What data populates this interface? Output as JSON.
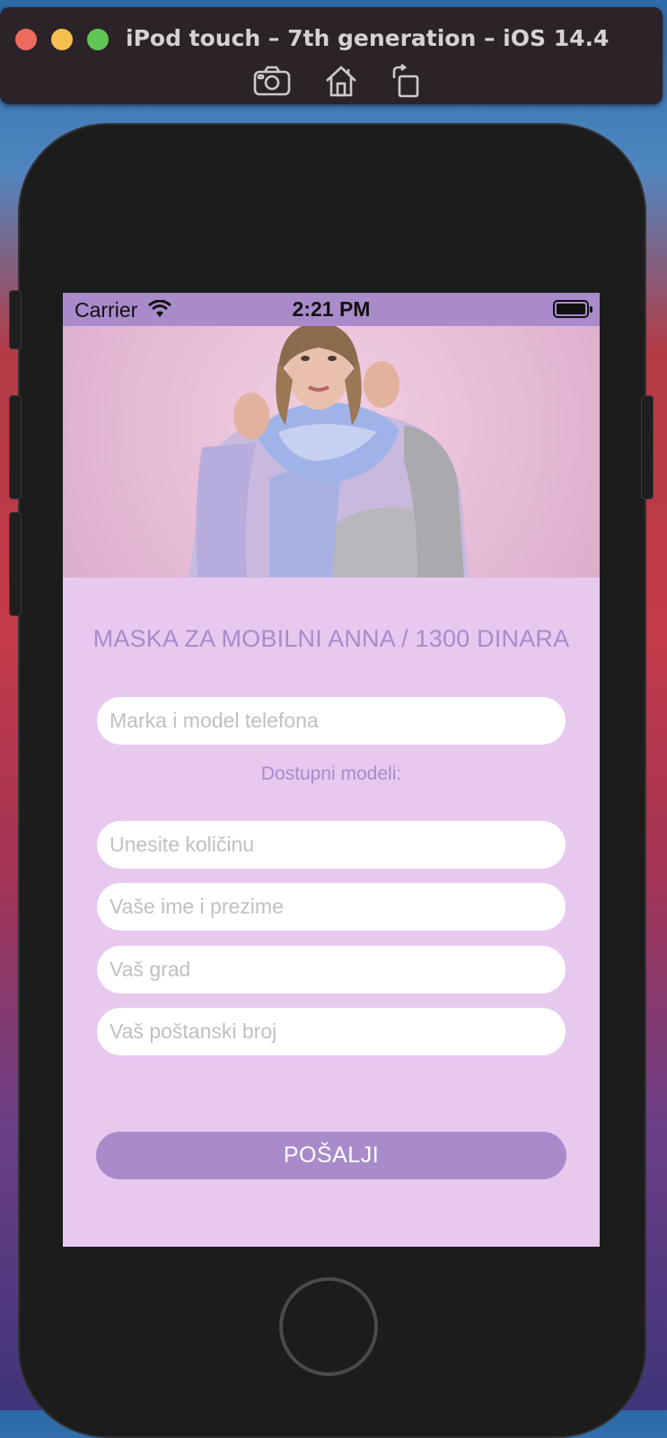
{
  "simulator": {
    "title": "iPod touch – 7th generation – iOS 14.4",
    "toolbar": [
      {
        "icon": "camera-icon",
        "action": "screenshot"
      },
      {
        "icon": "home-icon",
        "action": "home"
      },
      {
        "icon": "rotate-icon",
        "action": "rotate"
      }
    ]
  },
  "status_bar": {
    "carrier": "Carrier",
    "time": "2:21 PM",
    "wifi_icon": "wifi-icon",
    "battery_icon": "battery-icon"
  },
  "hero": {
    "image": "woman wearing lilac hoodie with face mask"
  },
  "product": {
    "title": "MASKA ZA MOBILNI ANNA / 1300 DINARA"
  },
  "form": {
    "phone_model_placeholder": "Marka i model telefona",
    "available_models_label": "Dostupni modeli:",
    "quantity_placeholder": "Unesite količinu",
    "name_placeholder": "Vaše ime i prezime",
    "city_placeholder": "Vaš grad",
    "postal_placeholder": "Vaš poštanski broj",
    "submit_label": "POŠALJI"
  },
  "colors": {
    "accent": "#a98bcb",
    "background": "#e7c8ef",
    "field": "#ffffff"
  }
}
